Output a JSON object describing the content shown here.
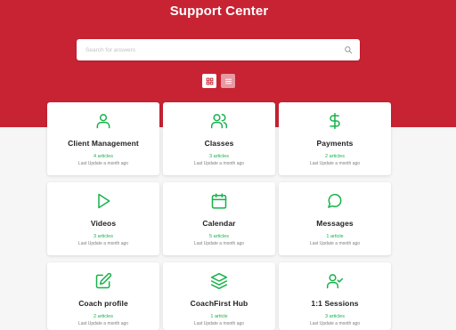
{
  "header": {
    "title": "Support Center"
  },
  "search": {
    "placeholder": "Search for answers"
  },
  "view_toggle": {
    "grid_icon": "grid-icon",
    "list_icon": "list-icon",
    "active": "grid"
  },
  "colors": {
    "brand": "#c82333",
    "accent": "#17b24a",
    "background": "#f6f6f6"
  },
  "categories": [
    {
      "name": "Client Management",
      "icon": "user-icon",
      "count": "4 articles",
      "updated": "Last Update a month ago"
    },
    {
      "name": "Classes",
      "icon": "users-icon",
      "count": "3 articles",
      "updated": "Last Update a month ago"
    },
    {
      "name": "Payments",
      "icon": "dollar-icon",
      "count": "2 articles",
      "updated": "Last Update a month ago"
    },
    {
      "name": "Videos",
      "icon": "play-icon",
      "count": "3 articles",
      "updated": "Last Update a month ago"
    },
    {
      "name": "Calendar",
      "icon": "calendar-icon",
      "count": "5 articles",
      "updated": "Last Update a month ago"
    },
    {
      "name": "Messages",
      "icon": "message-icon",
      "count": "1 article",
      "updated": "Last Update a month ago"
    },
    {
      "name": "Coach profile",
      "icon": "edit-icon",
      "count": "2 articles",
      "updated": "Last Update a month ago"
    },
    {
      "name": "CoachFirst Hub",
      "icon": "layers-icon",
      "count": "1 article",
      "updated": "Last Update a month ago"
    },
    {
      "name": "1:1 Sessions",
      "icon": "user-check-icon",
      "count": "3 articles",
      "updated": "Last Update a month ago"
    }
  ]
}
